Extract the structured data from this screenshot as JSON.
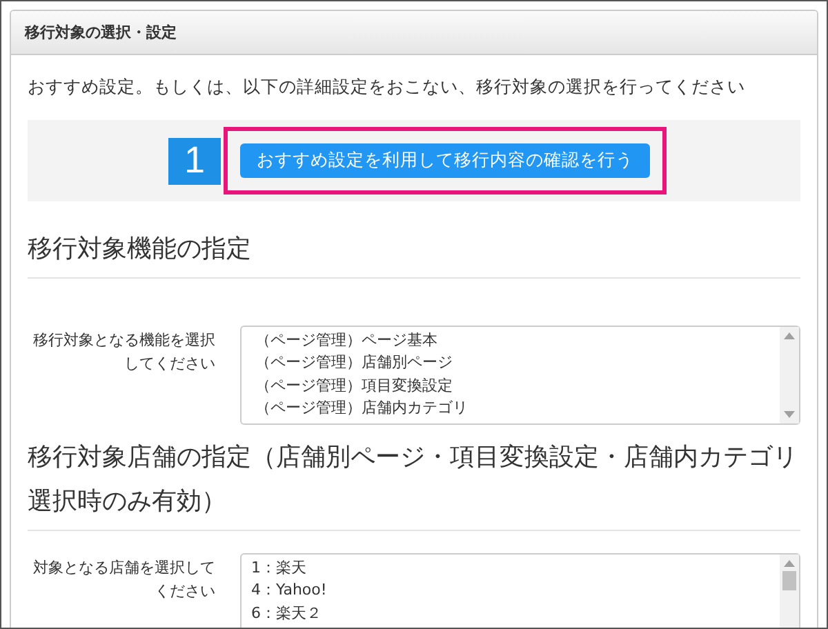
{
  "panel": {
    "title": "移行対象の選択・設定",
    "intro": "おすすめ設定。もしくは、以下の詳細設定をおこない、移行対象の選択を行ってください",
    "recommend": {
      "step": "1",
      "button": "おすすめ設定を利用して移行内容の確認を行う",
      "highlighted": true
    }
  },
  "sections": [
    {
      "heading": "移行対象機能の指定",
      "label": "移行対象となる機能を選択してください",
      "options": [
        "（ページ管理）ページ基本",
        "（ページ管理）店舗別ページ",
        "（ページ管理）項目変換設定",
        "（ページ管理）店舗内カテゴリ"
      ]
    },
    {
      "heading": "移行対象店舗の指定（店舗別ページ・項目変換設定・店舗内カテゴリ選択時のみ有効）",
      "label": "対象となる店舗を選択してください",
      "options": [
        "1：楽天",
        "4：Yahoo!",
        "6：楽天２"
      ]
    }
  ]
}
